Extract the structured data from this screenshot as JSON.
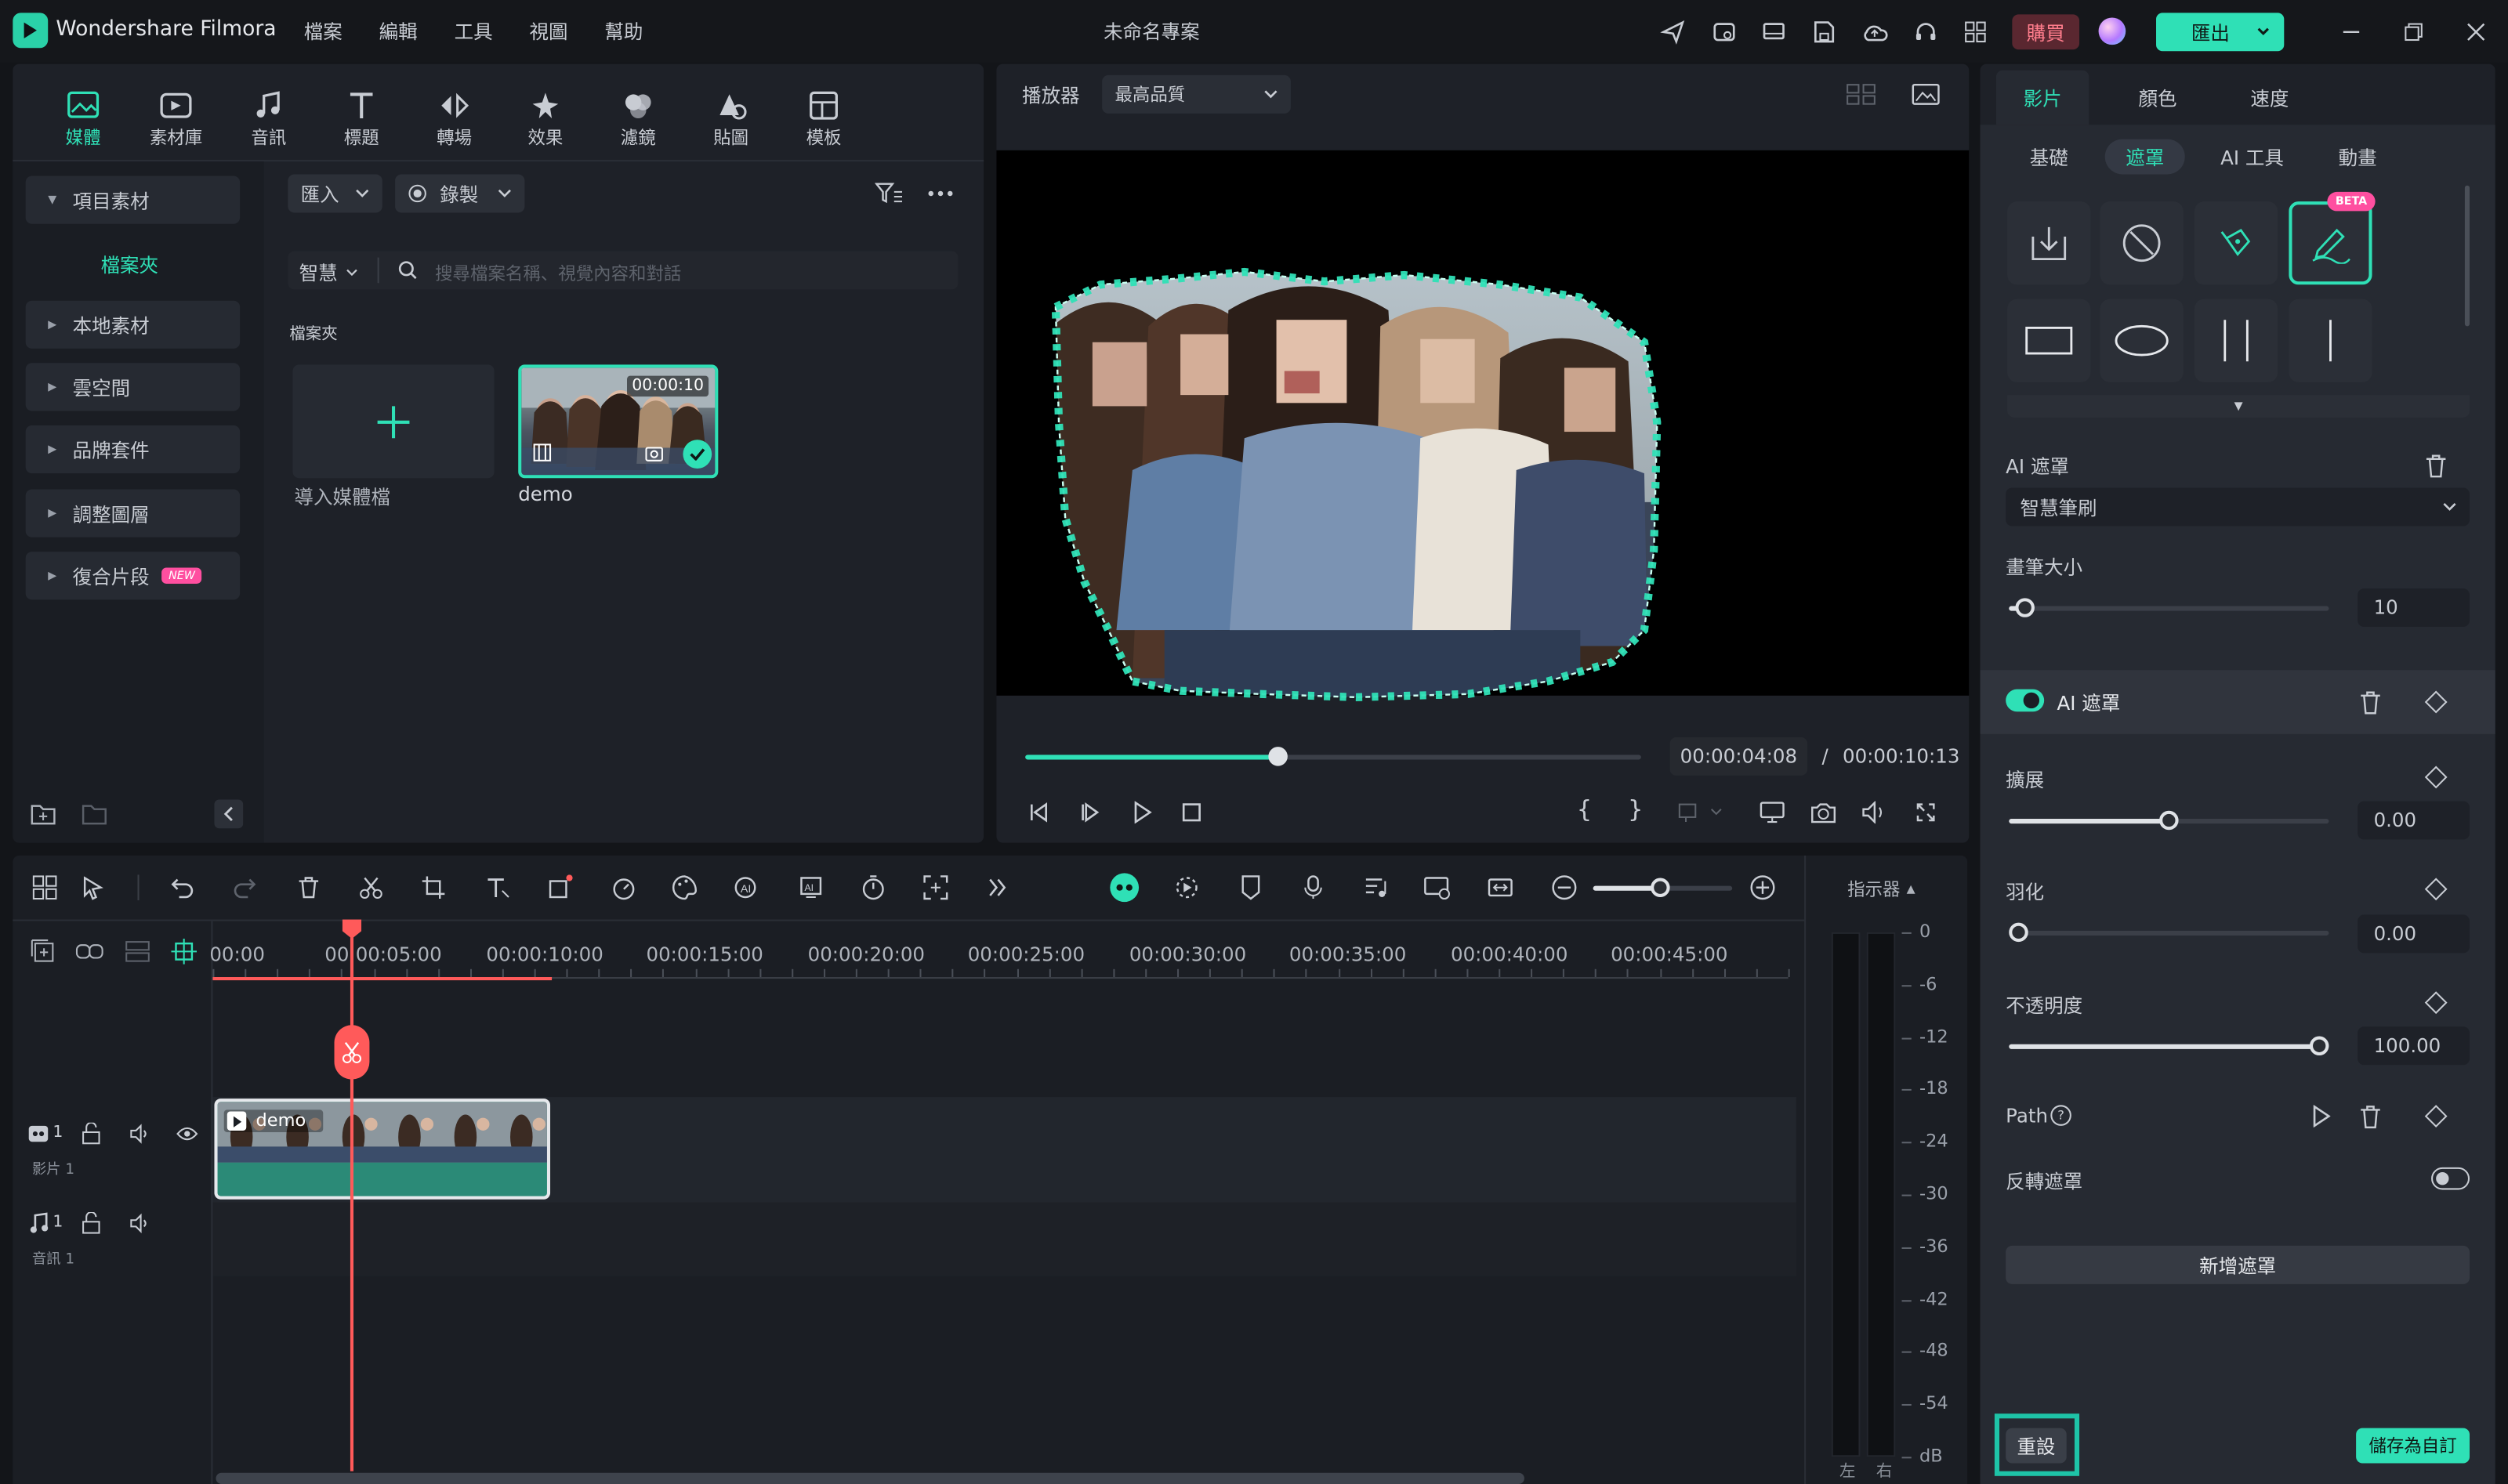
{
  "app": {
    "name": "Wondershare Filmora",
    "project_title": "未命名專案"
  },
  "menu": [
    "檔案",
    "編輯",
    "工具",
    "視圖",
    "幫助"
  ],
  "titlebar": {
    "buy_label": "購買",
    "export_label": "匯出"
  },
  "media_tabs": [
    {
      "label": "媒體",
      "icon": "media-icon",
      "active": true
    },
    {
      "label": "素材庫",
      "icon": "stock-icon"
    },
    {
      "label": "音訊",
      "icon": "music-icon"
    },
    {
      "label": "標題",
      "icon": "title-icon"
    },
    {
      "label": "轉場",
      "icon": "transition-icon"
    },
    {
      "label": "效果",
      "icon": "effects-icon"
    },
    {
      "label": "濾鏡",
      "icon": "filters-icon"
    },
    {
      "label": "貼圖",
      "icon": "stickers-icon"
    },
    {
      "label": "模板",
      "icon": "templates-icon"
    }
  ],
  "sidebar": {
    "project_media": "項目素材",
    "folder": "檔案夾",
    "items": [
      "本地素材",
      "雲空間",
      "品牌套件",
      "調整圖層",
      "復合片段"
    ],
    "new_badge": "NEW"
  },
  "media_toolbar": {
    "import_label": "匯入",
    "record_label": "錄製",
    "smart_label": "智慧",
    "search_placeholder": "搜尋檔案名稱、視覺內容和對話"
  },
  "media_grid": {
    "folder_label": "檔案夾",
    "import_tile_label": "導入媒體檔",
    "clip": {
      "name": "demo",
      "duration": "00:00:10"
    }
  },
  "player": {
    "label": "播放器",
    "quality": "最高品質",
    "current_time": "00:00:04:08",
    "separator": "/",
    "total_time": "00:00:10:13",
    "progress": 0.41
  },
  "timeline": {
    "ruler": [
      "00:00",
      "00:00:05:00",
      "00:00:10:00",
      "00:00:15:00",
      "00:00:20:00",
      "00:00:25:00",
      "00:00:30:00",
      "00:00:35:00",
      "00:00:40:00",
      "00:00:45:00"
    ],
    "clip_name": "demo",
    "video_track": {
      "index": "1",
      "name": "影片 1"
    },
    "audio_track": {
      "index": "1",
      "name": "音訊 1"
    },
    "meter_label": "指示器",
    "db_scale": [
      "0",
      "-6",
      "-12",
      "-18",
      "-24",
      "-30",
      "-36",
      "-42",
      "-48",
      "-54",
      "dB"
    ],
    "meter_left": "左",
    "meter_right": "右",
    "zoom_level": 0.55
  },
  "right_panel": {
    "top_tabs": [
      {
        "label": "影片",
        "active": true
      },
      {
        "label": "顏色"
      },
      {
        "label": "速度"
      }
    ],
    "sub_tabs": [
      {
        "label": "基礎"
      },
      {
        "label": "遮罩",
        "active": true
      },
      {
        "label": "AI 工具"
      },
      {
        "label": "動畫"
      }
    ],
    "beta_badge": "BETA",
    "ai_mask_section": "AI 遮罩",
    "ai_mask_mode": "智慧筆刷",
    "brush_size_label": "畫筆大小",
    "brush_size_value": "10",
    "brush_size_fraction": 0.05,
    "mask_item_label": "AI 遮罩",
    "expand_label": "擴展",
    "expand_value": "0.00",
    "expand_fraction": 0.5,
    "feather_label": "羽化",
    "feather_value": "0.00",
    "feather_fraction": 0.0,
    "opacity_label": "不透明度",
    "opacity_value": "100.00",
    "opacity_fraction": 1.0,
    "path_label": "Path",
    "invert_label": "反轉遮罩",
    "add_mask_label": "新增遮罩",
    "reset_label": "重設",
    "save_label": "儲存為自訂"
  },
  "colors": {
    "accent": "#2fe0b6",
    "playhead": "#ff5a5a",
    "buy": "#e04a5e"
  }
}
